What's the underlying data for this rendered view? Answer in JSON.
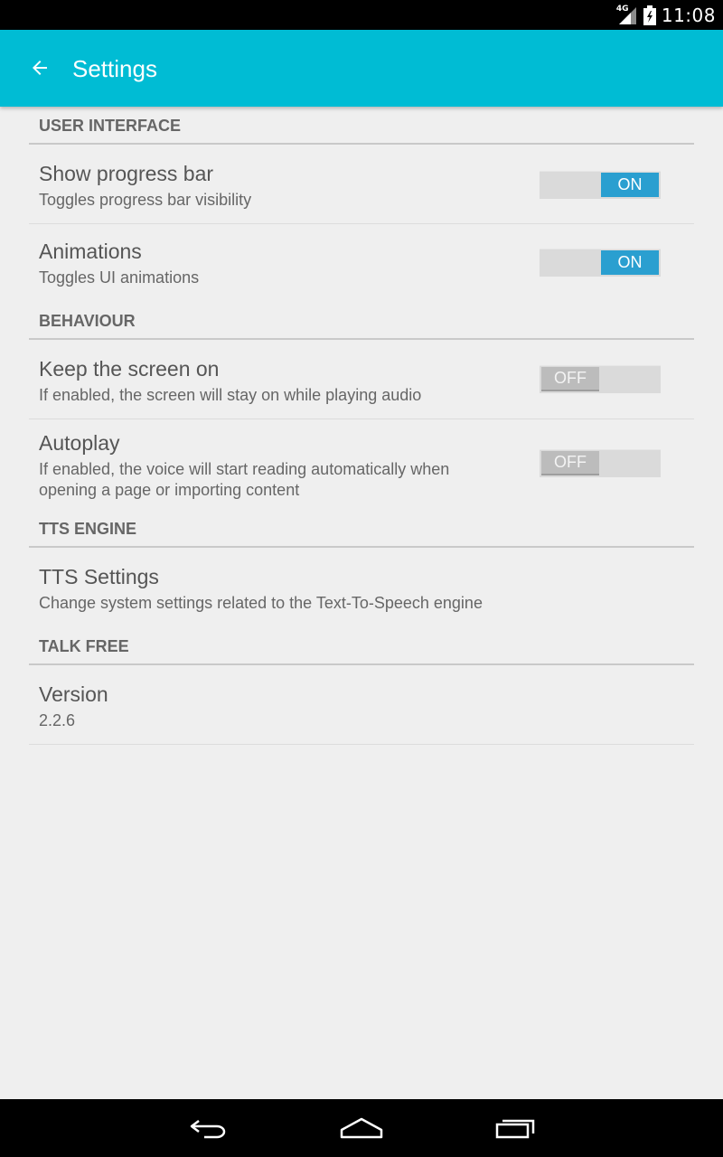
{
  "status_bar": {
    "network_label": "4G",
    "time": "11:08",
    "icons": [
      "signal-icon",
      "battery-icon"
    ]
  },
  "action_bar": {
    "title": "Settings",
    "back_icon": "arrow-back-icon",
    "color": "#00bcd4"
  },
  "sections": {
    "user_interface": {
      "label": "USER INTERFACE",
      "show_progress_bar": {
        "title": "Show progress bar",
        "summary": "Toggles progress bar visibility",
        "state": "ON"
      },
      "animations": {
        "title": "Animations",
        "summary": "Toggles UI animations",
        "state": "ON"
      }
    },
    "behaviour": {
      "label": "BEHAVIOUR",
      "keep_screen_on": {
        "title": "Keep the screen on",
        "summary": "If enabled, the screen will stay on while playing audio",
        "state": "OFF"
      },
      "autoplay": {
        "title": "Autoplay",
        "summary": "If enabled, the voice will start reading automatically when opening a page or importing content",
        "state": "OFF"
      }
    },
    "tts_engine": {
      "label": "TTS ENGINE",
      "tts_settings": {
        "title": "TTS Settings",
        "summary": "Change system settings related to the Text-To-Speech engine"
      }
    },
    "talk_free": {
      "label": "TALK FREE",
      "version": {
        "title": "Version",
        "summary": "2.2.6"
      }
    }
  },
  "colors": {
    "switch_on": "#2a9fd0",
    "switch_off": "#bcbcbc",
    "background": "#efefef"
  },
  "nav_bar": {
    "icons": [
      "back-nav-icon",
      "home-nav-icon",
      "recents-nav-icon"
    ]
  }
}
